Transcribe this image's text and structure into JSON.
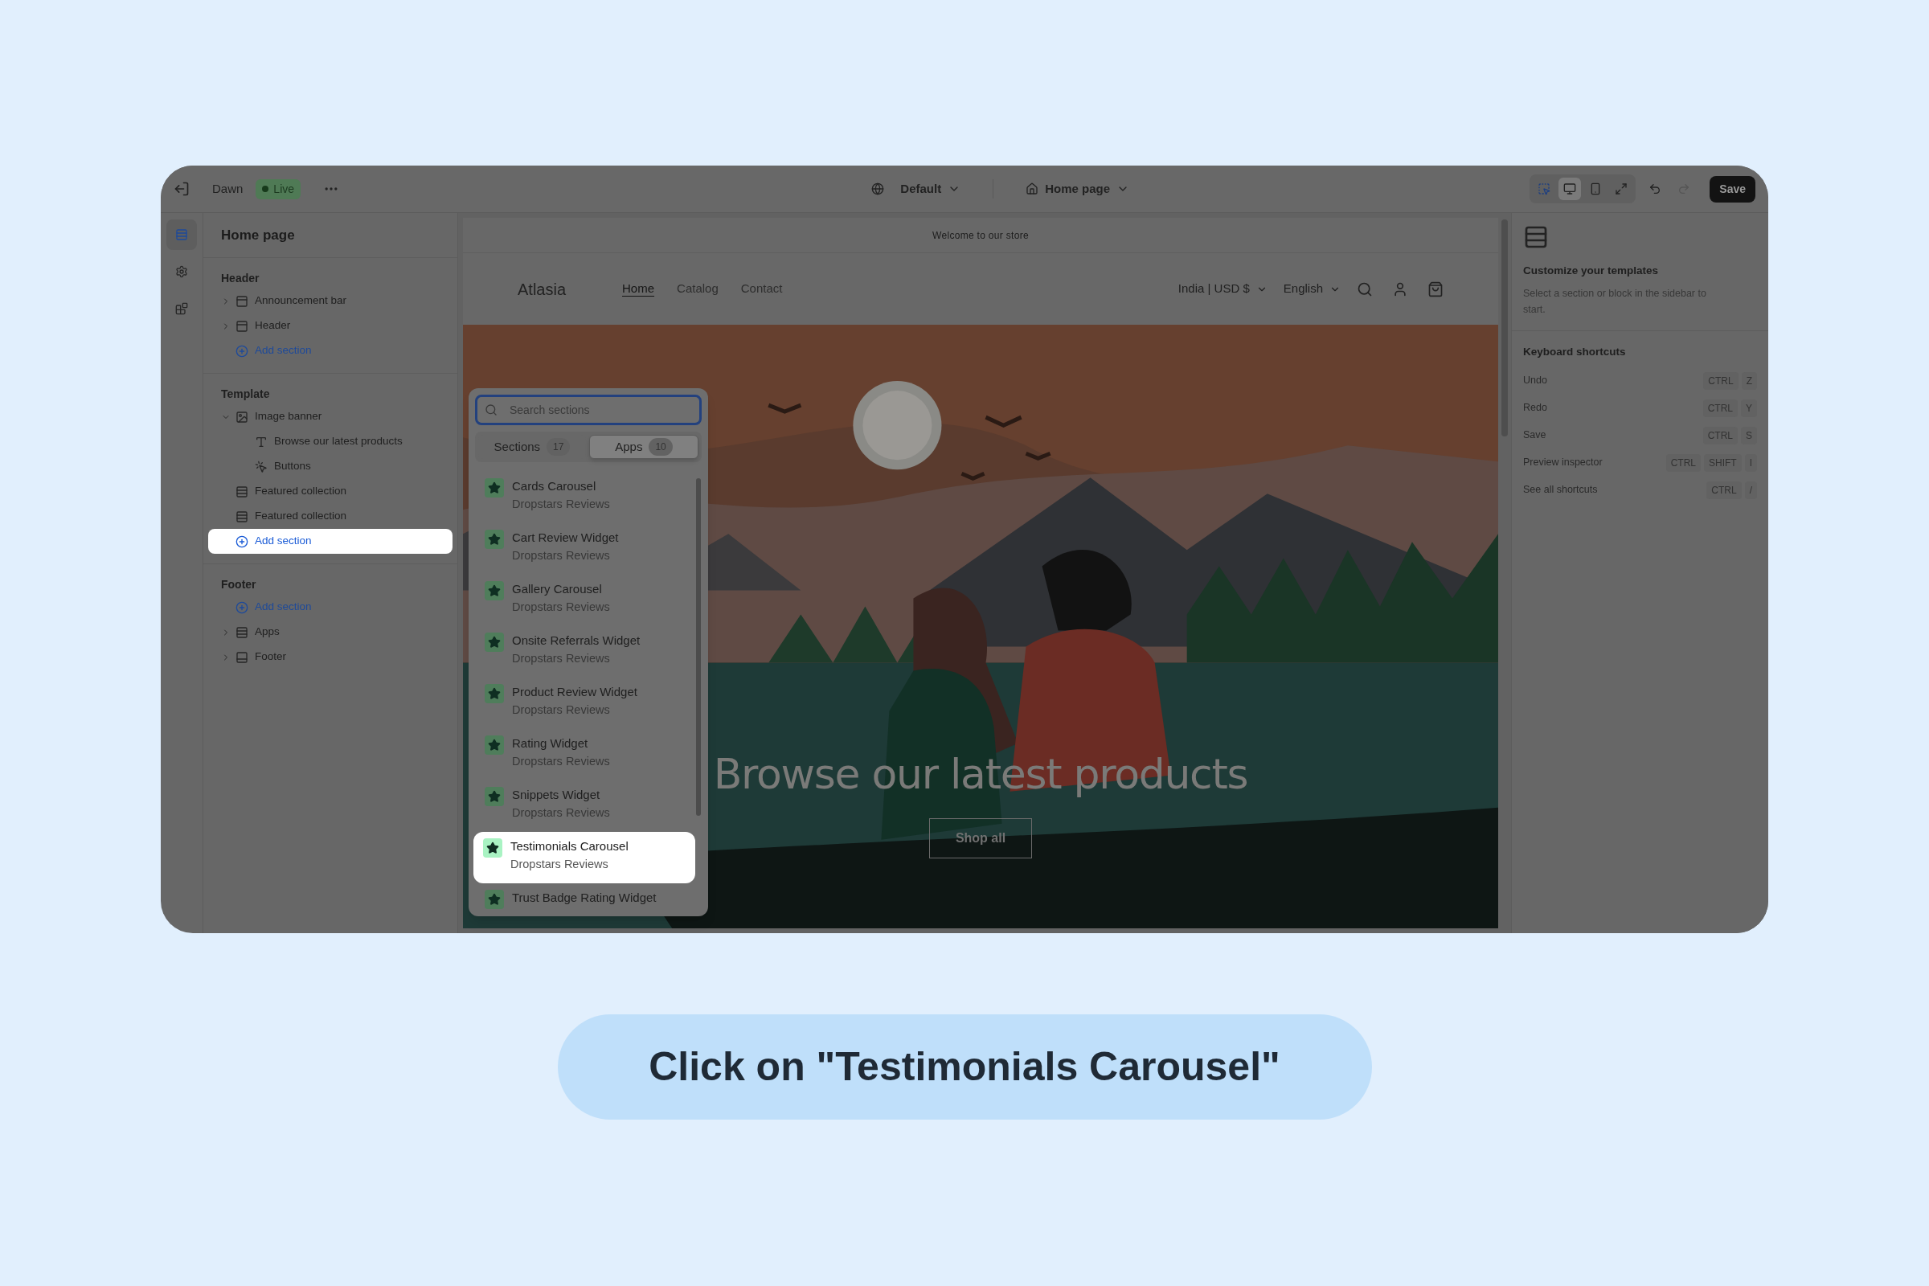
{
  "topbar": {
    "theme": "Dawn",
    "status": "Live",
    "preset": "Default",
    "page": "Home page",
    "save": "Save",
    "view_modes": [
      {
        "kind": "inspector",
        "selected": false
      },
      {
        "kind": "desktop",
        "selected": true
      },
      {
        "kind": "mobile",
        "selected": false
      },
      {
        "kind": "fullwidth",
        "selected": false
      }
    ]
  },
  "rail": [
    {
      "kind": "sections",
      "selected": true
    },
    {
      "kind": "settings",
      "selected": false
    },
    {
      "kind": "apps",
      "selected": false
    }
  ],
  "sidebar": {
    "title": "Home page",
    "groups": [
      {
        "heading": "Header",
        "items": [
          {
            "kind": "bar",
            "label": "Announcement bar",
            "expanded": false
          },
          {
            "kind": "bar",
            "label": "Header",
            "expanded": false
          },
          {
            "kind": "add",
            "label": "Add section",
            "highlighted": false
          }
        ]
      },
      {
        "heading": "Template",
        "items": [
          {
            "kind": "image",
            "label": "Image banner",
            "expanded": true,
            "children": [
              {
                "kind": "text",
                "label": "Browse our latest products"
              },
              {
                "kind": "button",
                "label": "Buttons"
              }
            ]
          },
          {
            "kind": "collection",
            "label": "Featured collection"
          },
          {
            "kind": "collection",
            "label": "Featured collection"
          },
          {
            "kind": "add",
            "label": "Add section",
            "highlighted": true
          }
        ]
      },
      {
        "heading": "Footer",
        "items": [
          {
            "kind": "add",
            "label": "Add section",
            "highlighted": false
          },
          {
            "kind": "collection",
            "label": "Apps",
            "expanded": false
          },
          {
            "kind": "footer",
            "label": "Footer",
            "expanded": false
          }
        ]
      }
    ]
  },
  "preview": {
    "announcement": "Welcome to our store",
    "logo": "Atlasia",
    "nav": [
      {
        "label": "Home",
        "selected": true
      },
      {
        "label": "Catalog",
        "selected": false
      },
      {
        "label": "Contact",
        "selected": false
      }
    ],
    "locale": "India | USD $",
    "language": "English",
    "hero": {
      "heading": "Browse our latest products",
      "button": "Shop all"
    }
  },
  "picker": {
    "placeholder": "Search sections",
    "tabs": [
      {
        "label": "Sections",
        "count": "17",
        "selected": false
      },
      {
        "label": "Apps",
        "count": "10",
        "selected": true
      }
    ],
    "items": [
      {
        "name": "Cards Carousel",
        "app": "Dropstars Reviews",
        "highlighted": false
      },
      {
        "name": "Cart Review Widget",
        "app": "Dropstars Reviews",
        "highlighted": false
      },
      {
        "name": "Gallery Carousel",
        "app": "Dropstars Reviews",
        "highlighted": false
      },
      {
        "name": "Onsite Referrals Widget",
        "app": "Dropstars Reviews",
        "highlighted": false
      },
      {
        "name": "Product Review Widget",
        "app": "Dropstars Reviews",
        "highlighted": false
      },
      {
        "name": "Rating Widget",
        "app": "Dropstars Reviews",
        "highlighted": false
      },
      {
        "name": "Snippets Widget",
        "app": "Dropstars Reviews",
        "highlighted": false
      },
      {
        "name": "Testimonials Carousel",
        "app": "Dropstars Reviews",
        "highlighted": true
      },
      {
        "name": "Trust Badge Rating Widget",
        "highlighted": false
      }
    ]
  },
  "inspector": {
    "title": "Customize your templates",
    "description": "Select a section or block in the sidebar to start.",
    "shortcuts_heading": "Keyboard shortcuts",
    "shortcuts": [
      {
        "label": "Undo",
        "keys": [
          "CTRL",
          "Z"
        ]
      },
      {
        "label": "Redo",
        "keys": [
          "CTRL",
          "Y"
        ]
      },
      {
        "label": "Save",
        "keys": [
          "CTRL",
          "S"
        ]
      },
      {
        "label": "Preview inspector",
        "keys": [
          "CTRL",
          "SHIFT",
          "I"
        ]
      },
      {
        "label": "See all shortcuts",
        "keys": [
          "CTRL",
          "/"
        ]
      }
    ]
  },
  "callout": "Click on \"Testimonials Carousel\""
}
